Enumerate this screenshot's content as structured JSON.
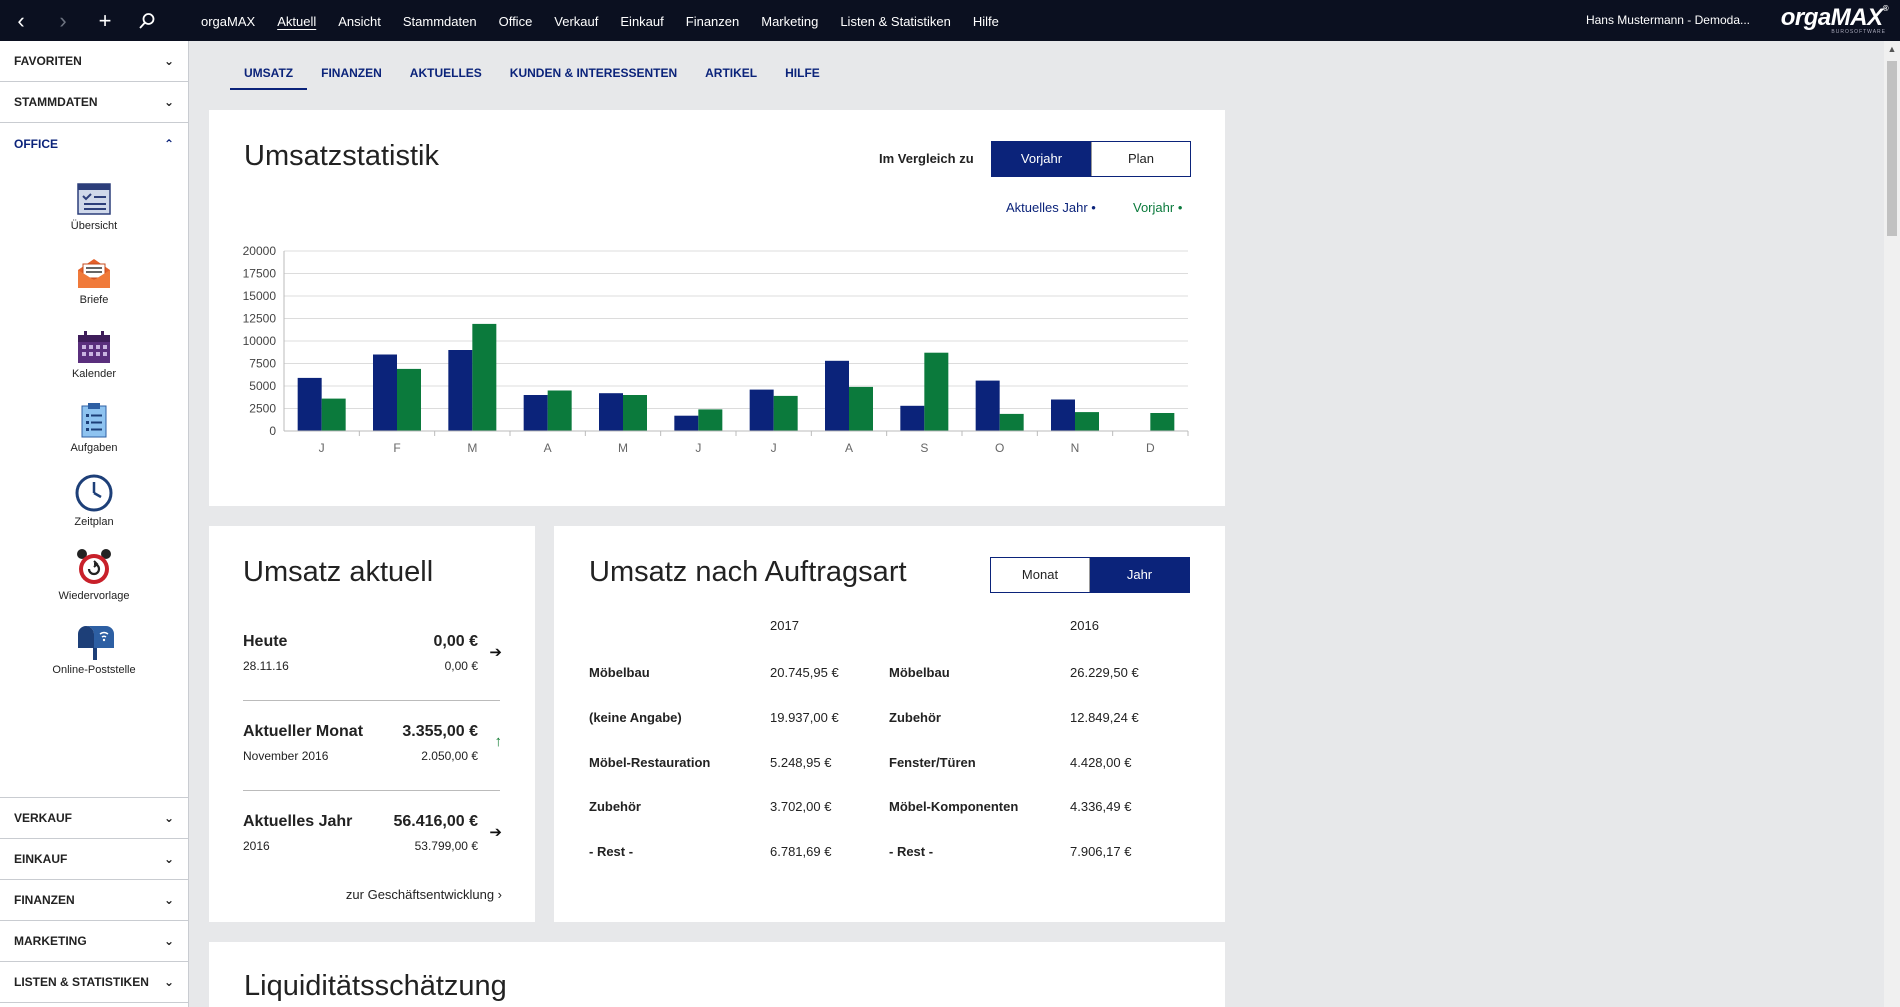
{
  "topbar": {
    "tools": [
      "‹",
      "›",
      "+",
      "⚲"
    ],
    "menu": [
      "orgaMAX",
      "Aktuell",
      "Ansicht",
      "Stammdaten",
      "Office",
      "Verkauf",
      "Einkauf",
      "Finanzen",
      "Marketing",
      "Listen & Statistiken",
      "Hilfe"
    ],
    "active_menu": "Aktuell",
    "user": "Hans Mustermann - Demoda...",
    "logo": "orgaMAX",
    "logo_sub": "BUROSOFTWARE"
  },
  "sidebar": {
    "heads_top": [
      "FAVORITEN",
      "STAMMDATEN",
      "OFFICE"
    ],
    "office_items": [
      {
        "label": "Übersicht",
        "icon": "overview-icon"
      },
      {
        "label": "Briefe",
        "icon": "letter-icon"
      },
      {
        "label": "Kalender",
        "icon": "calendar-icon"
      },
      {
        "label": "Aufgaben",
        "icon": "tasks-icon"
      },
      {
        "label": "Zeitplan",
        "icon": "clock-icon"
      },
      {
        "label": "Wiedervorlage",
        "icon": "alarm-clock-icon"
      },
      {
        "label": "Online-Poststelle",
        "icon": "mailbox-icon"
      }
    ],
    "heads_bottom": [
      "VERKAUF",
      "EINKAUF",
      "FINANZEN",
      "MARKETING",
      "LISTEN & STATISTIKEN"
    ]
  },
  "tabs": [
    "UMSATZ",
    "FINANZEN",
    "AKTUELLES",
    "KUNDEN & INTERESSENTEN",
    "ARTIKEL",
    "HILFE"
  ],
  "umsatzstatistik": {
    "title": "Umsatzstatistik",
    "compare_label": "Im Vergleich zu",
    "toggle": [
      "Vorjahr",
      "Plan"
    ],
    "legend": [
      {
        "label": "Aktuelles Jahr",
        "color": "#0b237a"
      },
      {
        "label": "Vorjahr",
        "color": "#0b7a3c"
      }
    ]
  },
  "chart_data": {
    "type": "bar",
    "categories": [
      "J",
      "F",
      "M",
      "A",
      "M",
      "J",
      "J",
      "A",
      "S",
      "O",
      "N",
      "D"
    ],
    "series": [
      {
        "name": "Aktuelles Jahr",
        "color": "#0b237a",
        "values": [
          5900,
          8500,
          9000,
          4000,
          4200,
          1700,
          4600,
          7800,
          2800,
          5600,
          3500,
          0
        ]
      },
      {
        "name": "Vorjahr",
        "color": "#0b7a3c",
        "values": [
          3600,
          6900,
          11900,
          4500,
          4000,
          2400,
          3900,
          4900,
          8700,
          1900,
          2100,
          2000
        ]
      }
    ],
    "yticks": [
      "20000",
      "17500",
      "15000",
      "12500",
      "10000",
      "7500",
      "5000",
      "2500",
      "0"
    ],
    "ylim": [
      0,
      20000
    ]
  },
  "umsatz_aktuell": {
    "title": "Umsatz aktuell",
    "rows": [
      {
        "label": "Heute",
        "value": "0,00 €",
        "sub": "28.11.16",
        "sub_value": "0,00 €",
        "arrow": "➔"
      },
      {
        "label": "Aktueller Monat",
        "value": "3.355,00 €",
        "sub": "November 2016",
        "sub_value": "2.050,00 €",
        "arrow": "↑"
      },
      {
        "label": "Aktuelles Jahr",
        "value": "56.416,00 €",
        "sub": "2016",
        "sub_value": "53.799,00 €",
        "arrow": "➔"
      }
    ],
    "link": "zur Geschäftsentwicklung ›"
  },
  "auftragsart": {
    "title": "Umsatz nach Auftragsart",
    "toggle": [
      "Monat",
      "Jahr"
    ],
    "year_a": "2017",
    "year_b": "2016",
    "rows_a": [
      {
        "label": "Möbelbau",
        "value": "20.745,95 €"
      },
      {
        "label": "(keine Angabe)",
        "value": "19.937,00 €"
      },
      {
        "label": "Möbel-Restauration",
        "value": "5.248,95 €"
      },
      {
        "label": "Zubehör",
        "value": "3.702,00 €"
      },
      {
        "label": "- Rest -",
        "value": "6.781,69 €"
      }
    ],
    "rows_b": [
      {
        "label": "Möbelbau",
        "value": "26.229,50 €"
      },
      {
        "label": "Zubehör",
        "value": "12.849,24 €"
      },
      {
        "label": "Fenster/Türen",
        "value": "4.428,00 €"
      },
      {
        "label": "Möbel-Komponenten",
        "value": "4.336,49 €"
      },
      {
        "label": "- Rest -",
        "value": "7.906,17 €"
      }
    ]
  },
  "liquiditaet": {
    "title": "Liquiditätsschätzung"
  }
}
